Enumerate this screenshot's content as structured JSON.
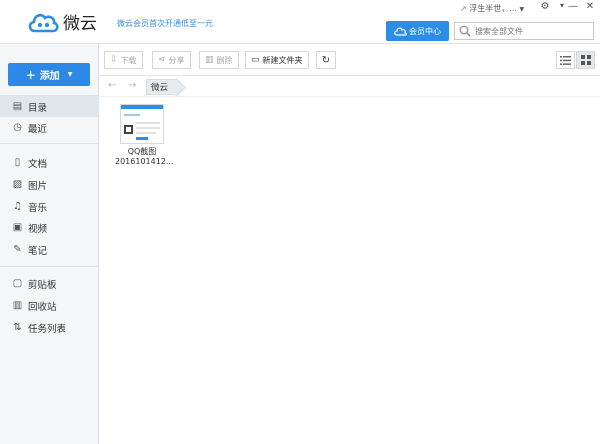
{
  "app": {
    "title": "微云",
    "promo": "微云会员首次开通低至一元"
  },
  "titlebar": {
    "user": "浮生半世，...",
    "minimize_glyph": "—",
    "close_glyph": "✕",
    "settings_glyph": "⚙"
  },
  "header": {
    "vip_label": "会员中心",
    "search_placeholder": "搜索全部文件"
  },
  "sidebar": {
    "add_label": "添加",
    "items": [
      {
        "label": "目录",
        "icon": "catalog-icon"
      },
      {
        "label": "最近",
        "icon": "clock-icon"
      },
      {
        "label": "文档",
        "icon": "document-icon"
      },
      {
        "label": "图片",
        "icon": "image-icon"
      },
      {
        "label": "音乐",
        "icon": "music-icon"
      },
      {
        "label": "视频",
        "icon": "video-icon"
      },
      {
        "label": "笔记",
        "icon": "note-icon"
      },
      {
        "label": "剪贴板",
        "icon": "clipboard-icon"
      },
      {
        "label": "回收站",
        "icon": "trash-icon"
      },
      {
        "label": "任务列表",
        "icon": "transfer-icon"
      }
    ]
  },
  "toolbar": {
    "download": "下载",
    "share": "分享",
    "delete": "删除",
    "new_folder": "新建文件夹"
  },
  "path": {
    "current": "微云"
  },
  "files": [
    {
      "name": "QQ截图",
      "name2": "2016101412..."
    }
  ],
  "colors": {
    "accent": "#2c8ae6",
    "sidebar_bg": "#f4f6f8"
  }
}
